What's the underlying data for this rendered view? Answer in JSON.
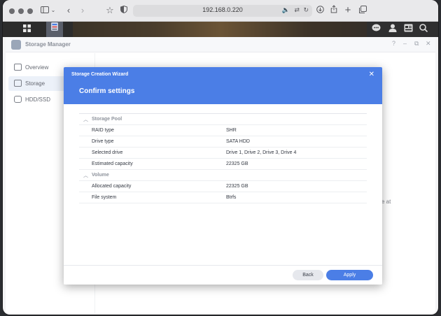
{
  "browser": {
    "url": "192.168.0.220",
    "icons": [
      "sidebar-toggle-icon",
      "chevron-down-icon",
      "back-arrow-icon",
      "forward-arrow-icon",
      "bookmark-star-icon",
      "shield-icon",
      "audio-icon",
      "translate-icon",
      "reload-icon",
      "download-icon",
      "share-icon",
      "new-tab-icon",
      "tabs-overview-icon"
    ]
  },
  "dsm_topbar": {
    "icons": [
      "main-menu-grid-icon",
      "storage-manager-app-icon",
      "chat-icon",
      "user-icon",
      "widgets-icon",
      "search-icon"
    ]
  },
  "app": {
    "title": "Storage Manager",
    "window_controls": [
      "help-icon",
      "minimize-icon",
      "maximize-icon",
      "close-icon"
    ]
  },
  "sidebar": {
    "items": [
      {
        "label": "Overview",
        "icon": "overview-icon",
        "active": false
      },
      {
        "label": "Storage",
        "icon": "storage-icon",
        "active": true
      },
      {
        "label": "HDD/SSD",
        "icon": "drive-icon",
        "active": false
      }
    ]
  },
  "background_fragment": "e at",
  "wizard": {
    "window_title": "Storage Creation Wizard",
    "step_title": "Confirm settings",
    "sections": [
      {
        "label": "Storage Pool",
        "rows": [
          {
            "key": "RAID type",
            "value": "SHR"
          },
          {
            "key": "Drive type",
            "value": "SATA HDD"
          },
          {
            "key": "Selected drive",
            "value": "Drive 1, Drive 2, Drive 3, Drive 4"
          },
          {
            "key": "Estimated capacity",
            "value": "22325 GB"
          }
        ]
      },
      {
        "label": "Volume",
        "rows": [
          {
            "key": "Allocated capacity",
            "value": "22325 GB"
          },
          {
            "key": "File system",
            "value": "Btrfs"
          }
        ]
      }
    ],
    "buttons": {
      "back": "Back",
      "apply": "Apply"
    }
  },
  "colors": {
    "accent": "#4b7ee6",
    "sidebar_active": "#e6ecf7"
  }
}
